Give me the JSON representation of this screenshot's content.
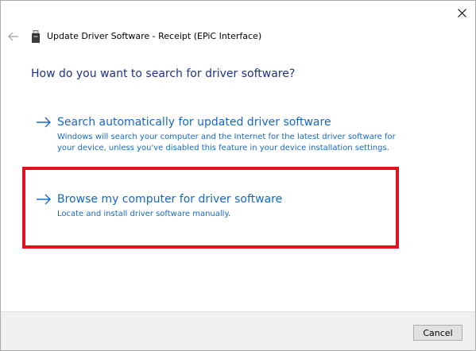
{
  "dialog": {
    "title": "Update Driver Software - Receipt (EPiC Interface)",
    "back_icon": "back-arrow-icon",
    "device_icon": "usb-device-icon",
    "close_icon": "close-icon"
  },
  "question": "How do you want to search for driver software?",
  "options": [
    {
      "title": "Search automatically for updated driver software",
      "description": "Windows will search your computer and the Internet for the latest driver software for your device, unless you've disabled this feature in your device installation settings.",
      "icon": "right-arrow-icon"
    },
    {
      "title": "Browse my computer for driver software",
      "description": "Locate and install driver software manually.",
      "icon": "right-arrow-icon",
      "highlighted": true
    }
  ],
  "footer": {
    "cancel_label": "Cancel"
  },
  "colors": {
    "question": "#1e3287",
    "link": "#1668c5",
    "highlight": "#e0121f",
    "footer_bg": "#f0f0f0"
  }
}
